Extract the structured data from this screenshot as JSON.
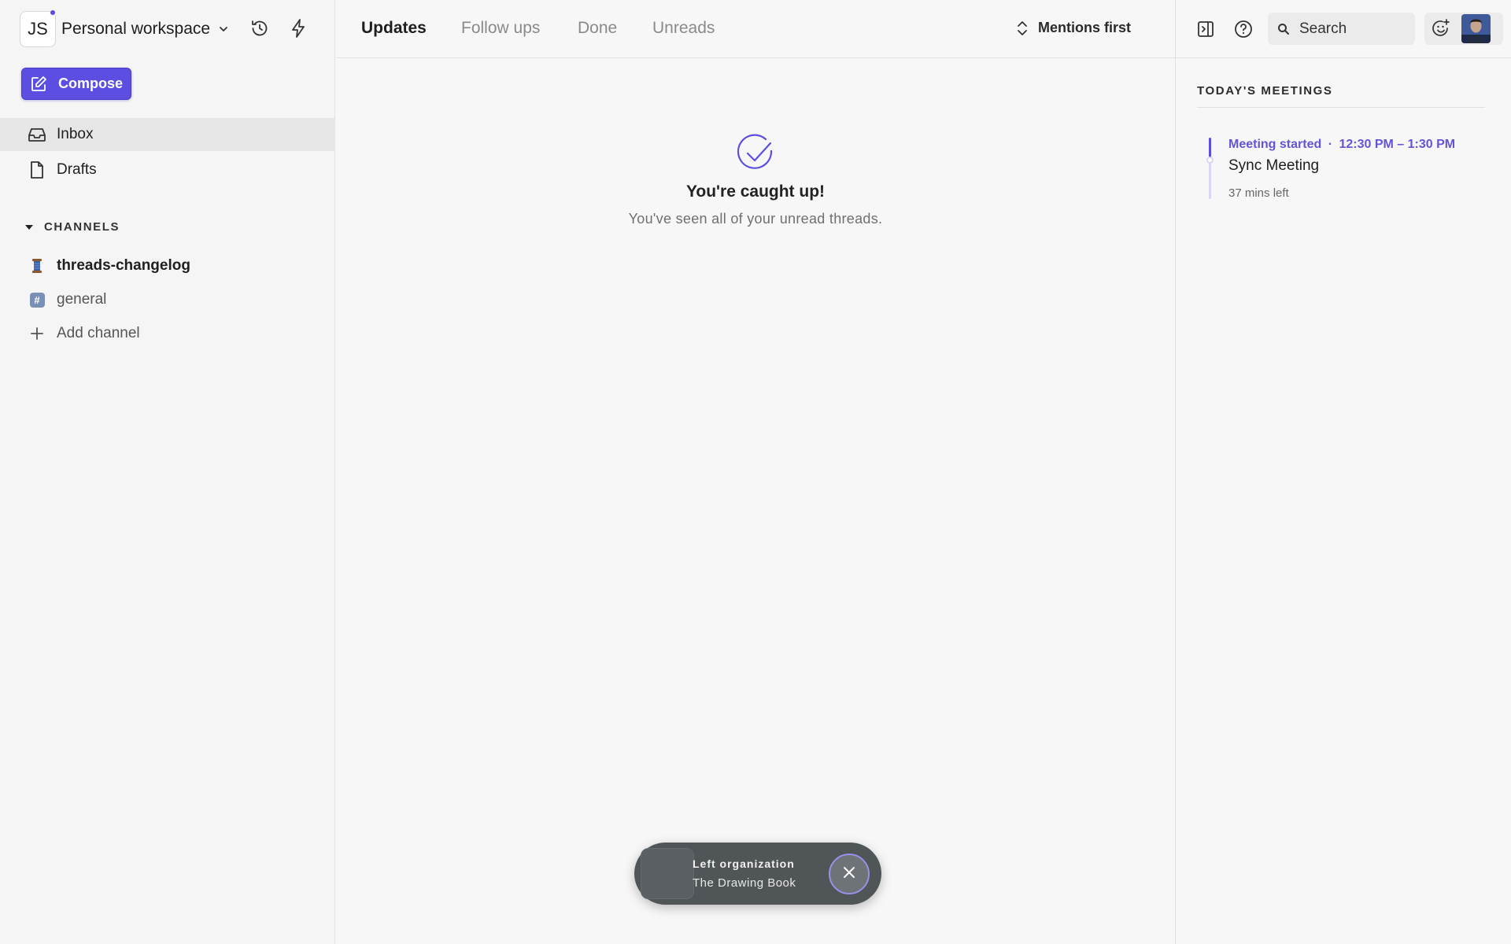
{
  "workspace": {
    "initials": "JS",
    "name": "Personal workspace"
  },
  "sidebar": {
    "compose_label": "Compose",
    "nav": [
      {
        "label": "Inbox"
      },
      {
        "label": "Drafts"
      }
    ],
    "channels_heading": "CHANNELS",
    "channels": [
      {
        "label": "threads-changelog",
        "icon": "spool-icon"
      },
      {
        "label": "general",
        "icon": "hash-icon"
      }
    ],
    "add_channel_label": "Add channel"
  },
  "tabs": [
    {
      "label": "Updates",
      "active": true
    },
    {
      "label": "Follow ups"
    },
    {
      "label": "Done"
    },
    {
      "label": "Unreads"
    }
  ],
  "sort": {
    "label": "Mentions first"
  },
  "empty_state": {
    "title": "You're caught up!",
    "subtitle": "You've seen all of your unread threads."
  },
  "toast": {
    "line1": "Left organization",
    "line2": "The Drawing Book"
  },
  "search": {
    "placeholder": "Search"
  },
  "meetings": {
    "heading": "TODAY'S MEETINGS",
    "items": [
      {
        "status": "Meeting started",
        "separator": "·",
        "time": "12:30 PM – 1:30 PM",
        "title": "Sync Meeting",
        "remaining": "37 mins left"
      }
    ]
  },
  "colors": {
    "accent": "#5b4ee0",
    "toast_bg": "#505558",
    "meeting_text": "#6355d6"
  }
}
